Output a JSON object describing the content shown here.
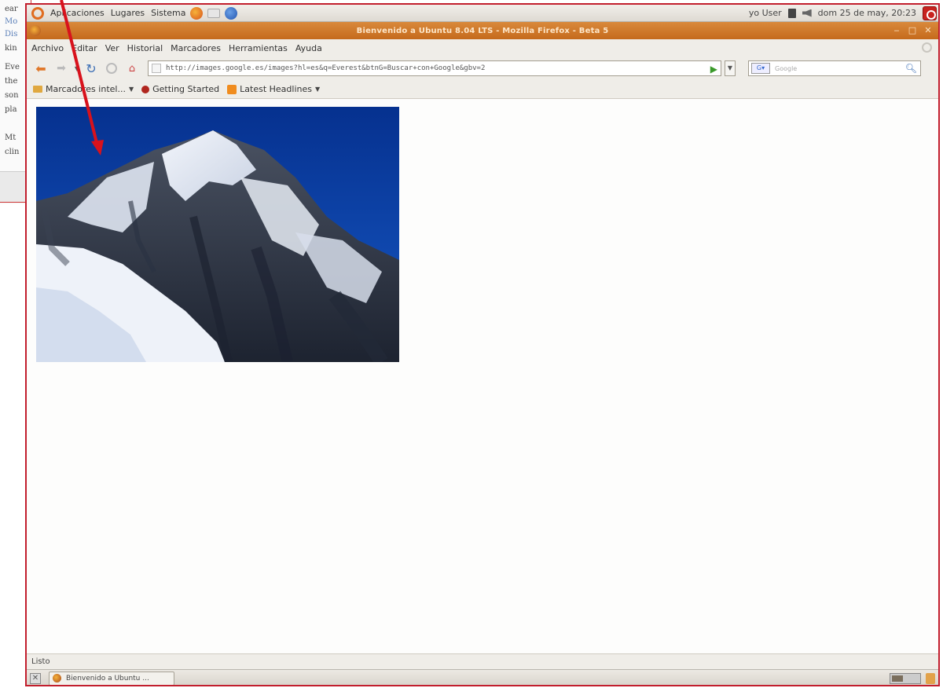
{
  "background_page": {
    "lines": [
      "ear",
      "Mo",
      "Dis",
      "kin",
      "Eve",
      "the",
      "son",
      "pla",
      "Mt",
      "clin"
    ]
  },
  "gnome_panel": {
    "menus": [
      "Aplicaciones",
      "Lugares",
      "Sistema"
    ],
    "user": "yo User",
    "datetime": "dom 25 de may, 20:23"
  },
  "window": {
    "title": "Bienvenido a Ubuntu 8.04 LTS - Mozilla Firefox - Beta 5"
  },
  "menu_bar": {
    "items": [
      "Archivo",
      "Editar",
      "Ver",
      "Historial",
      "Marcadores",
      "Herramientas",
      "Ayuda"
    ]
  },
  "nav": {
    "url": "http://images.google.es/images?hl=es&q=Everest&btnG=Buscar+con+Google&gbv=2"
  },
  "search": {
    "placeholder": "Google"
  },
  "bookmarks": {
    "items": [
      "Marcadores intel...",
      "Getting Started",
      "Latest Headlines"
    ]
  },
  "status_bar": {
    "text": "Listo"
  },
  "taskbar": {
    "window_button": "Bienvenido a Ubuntu ..."
  },
  "colors": {
    "frame_red": "#c21e2d",
    "title_orange": "#c56a1c",
    "sky_blue": "#0b3ea6"
  }
}
